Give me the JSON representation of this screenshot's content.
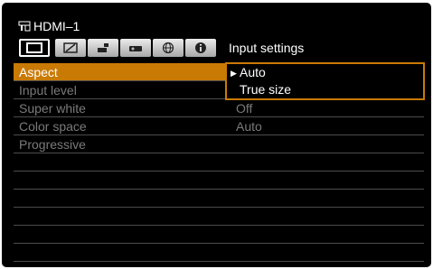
{
  "source": {
    "name": "HDMI–1",
    "icon": "hdmi-icon"
  },
  "tabs": {
    "items": [
      {
        "icon": "display-icon",
        "active": true
      },
      {
        "icon": "picture-adjust-icon",
        "active": false
      },
      {
        "icon": "installation-icon",
        "active": false
      },
      {
        "icon": "system-icon",
        "active": false
      },
      {
        "icon": "network-icon",
        "active": false
      },
      {
        "icon": "info-icon",
        "active": false
      }
    ],
    "active_title": "Input settings"
  },
  "menu": {
    "rows": [
      {
        "label": "Aspect",
        "value": ""
      },
      {
        "label": "Input level",
        "value": ""
      },
      {
        "label": "Super white",
        "value": "Off"
      },
      {
        "label": "Color space",
        "value": "Auto"
      },
      {
        "label": "Progressive",
        "value": ""
      },
      {
        "label": "",
        "value": ""
      },
      {
        "label": "",
        "value": ""
      },
      {
        "label": "",
        "value": ""
      },
      {
        "label": "",
        "value": ""
      },
      {
        "label": "",
        "value": ""
      },
      {
        "label": "",
        "value": ""
      }
    ]
  },
  "dropdown": {
    "options": [
      {
        "label": "Auto",
        "current": true
      },
      {
        "label": "True size",
        "current": false
      }
    ]
  },
  "colors": {
    "accent": "#c97a05",
    "background": "#000000",
    "text": "#ffffff",
    "dim_text": "#7a7a7a"
  }
}
